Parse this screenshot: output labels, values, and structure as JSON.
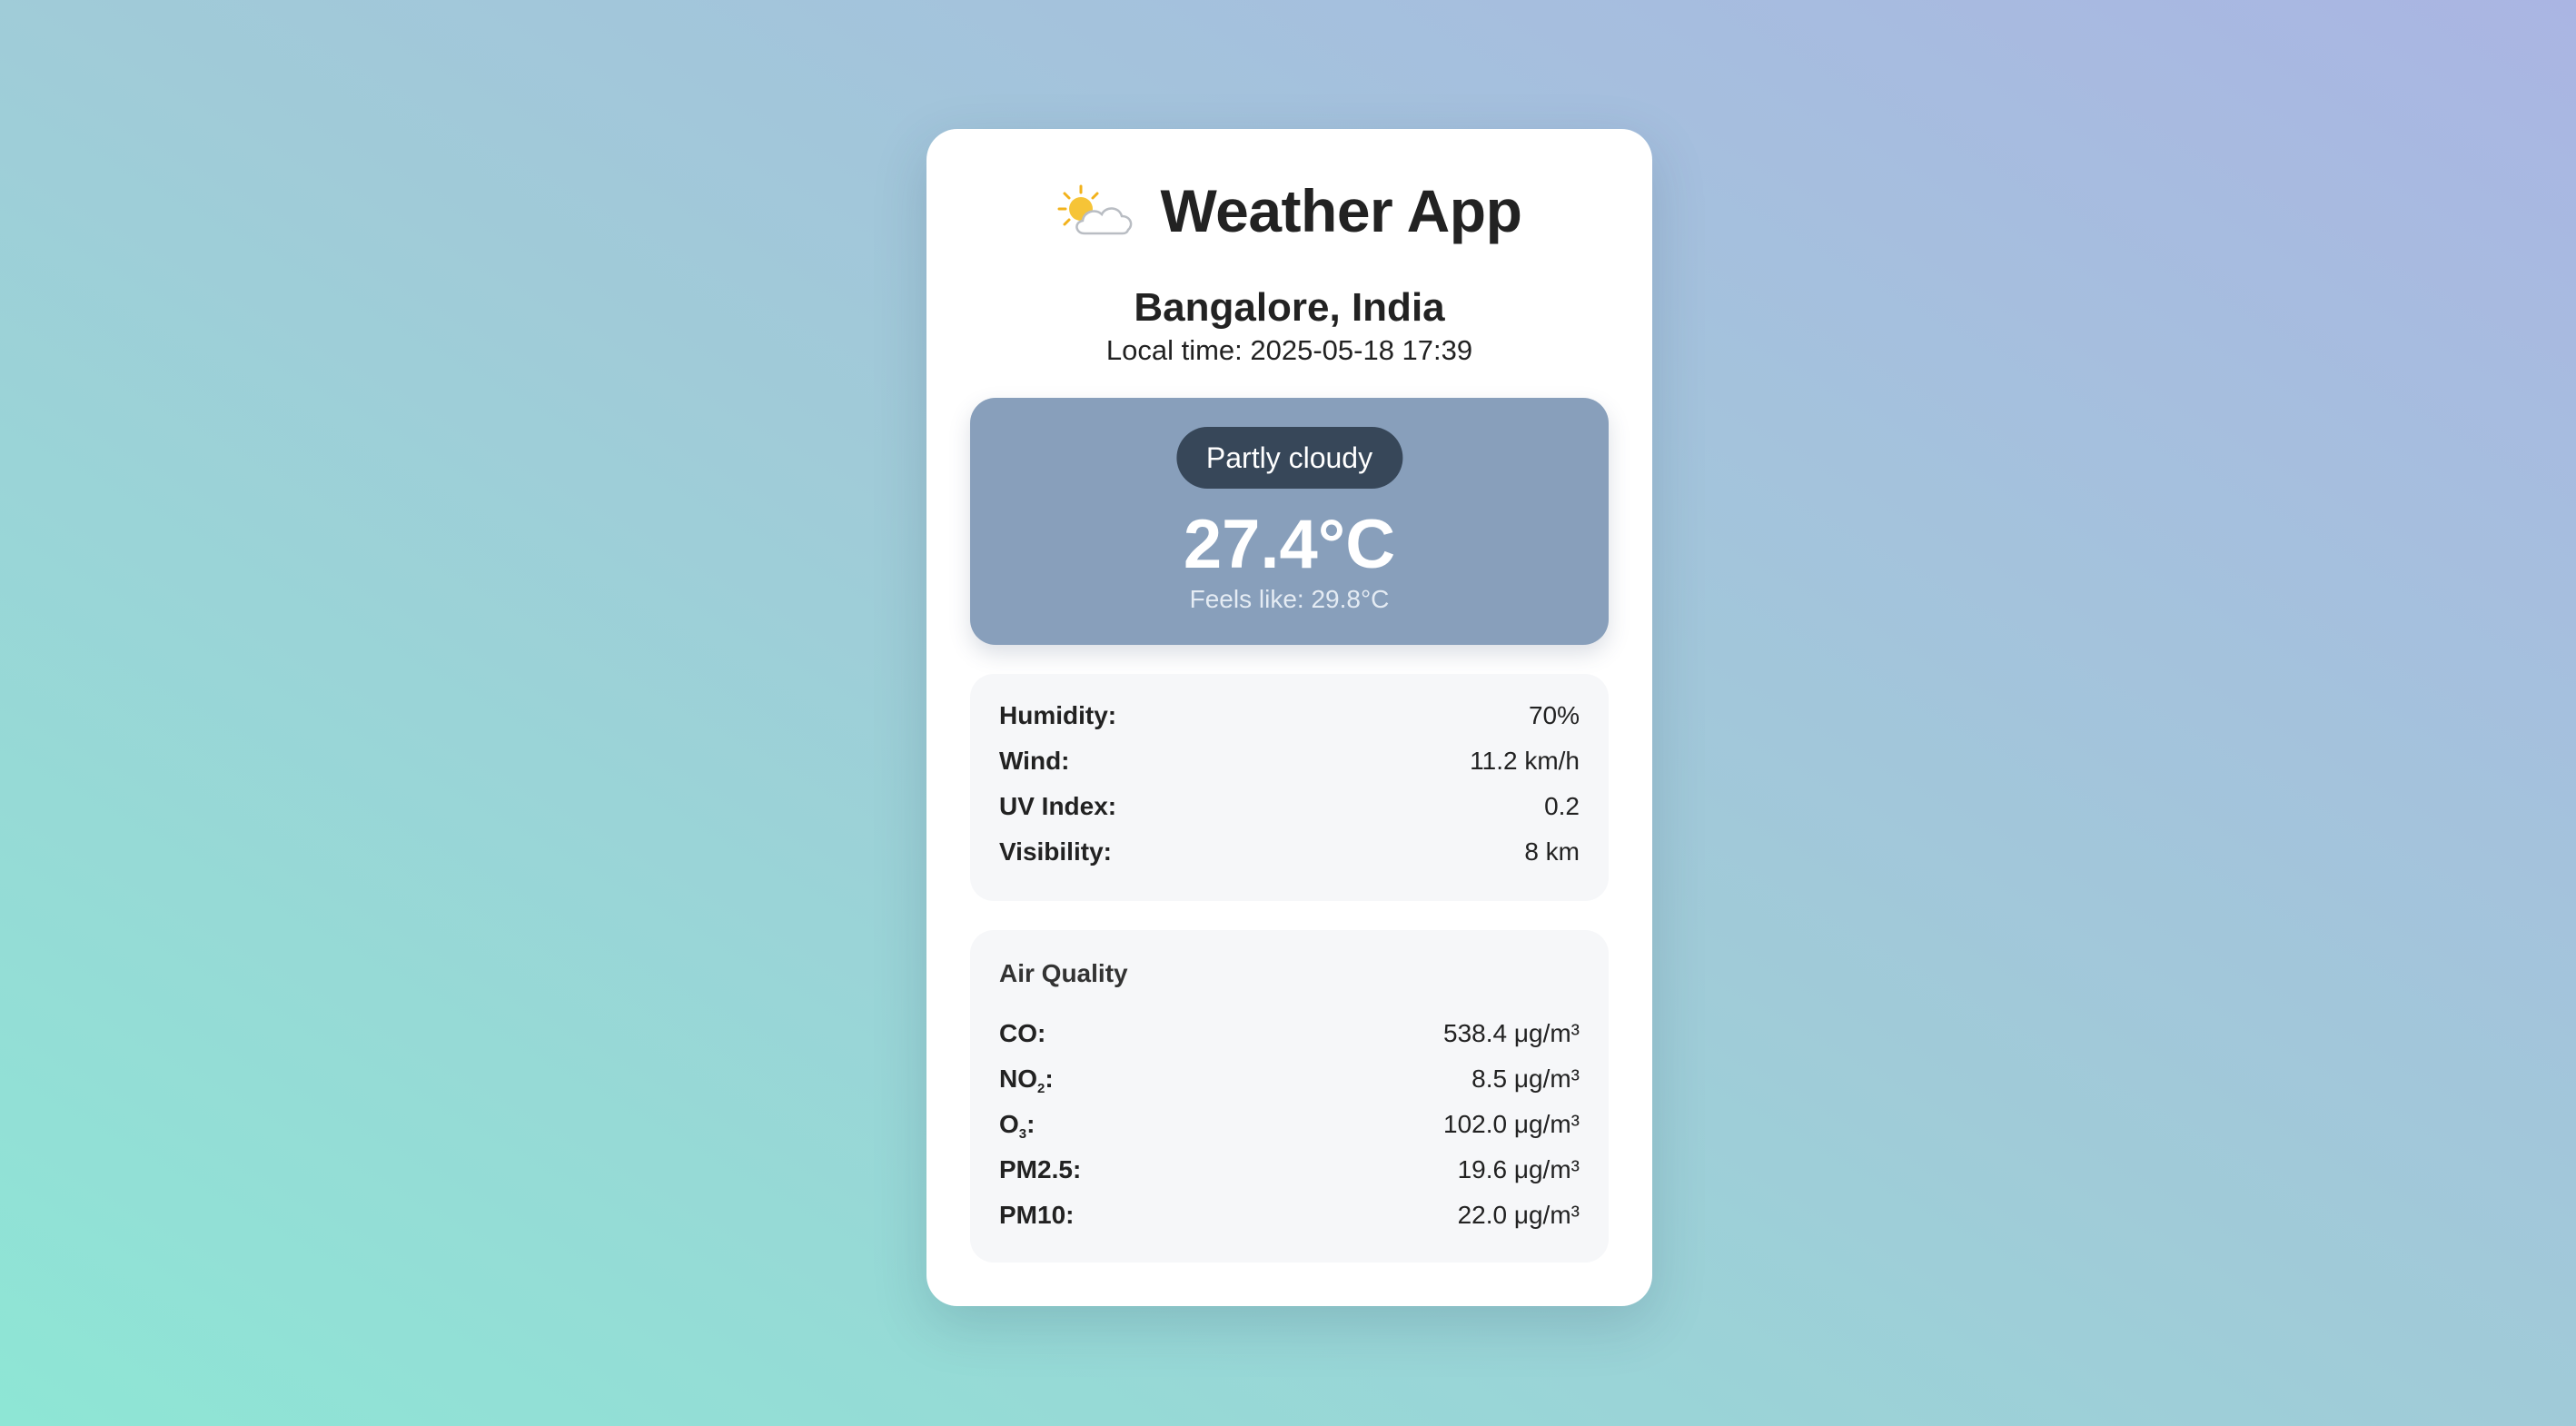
{
  "app": {
    "title": "Weather App",
    "icon": "sun-behind-cloud-icon"
  },
  "location": {
    "name": "Bangalore, India",
    "local_time": "Local time: 2025-05-18 17:39"
  },
  "current": {
    "condition": "Partly cloudy",
    "temperature": "27.4°C",
    "feels_like": "Feels like: 29.8°C"
  },
  "stats": [
    {
      "label": "Humidity:",
      "value": "70%"
    },
    {
      "label": "Wind:",
      "value": "11.2 km/h"
    },
    {
      "label": "UV Index:",
      "value": "0.2"
    },
    {
      "label": "Visibility:",
      "value": "8 km"
    }
  ],
  "air_quality": {
    "title": "Air Quality",
    "items": [
      {
        "label": "CO",
        "sub": "",
        "value": "538.4 μg/m³"
      },
      {
        "label": "NO",
        "sub": "2",
        "value": "8.5 μg/m³"
      },
      {
        "label": "O",
        "sub": "3",
        "value": "102.0 μg/m³"
      },
      {
        "label": "PM2.5",
        "sub": "",
        "value": "19.6 μg/m³"
      },
      {
        "label": "PM10",
        "sub": "",
        "value": "22.0 μg/m³"
      }
    ]
  },
  "colors": {
    "hero_background": "#889fbb",
    "condition_pill": "#374759",
    "panel_background": "#f6f7f9"
  }
}
